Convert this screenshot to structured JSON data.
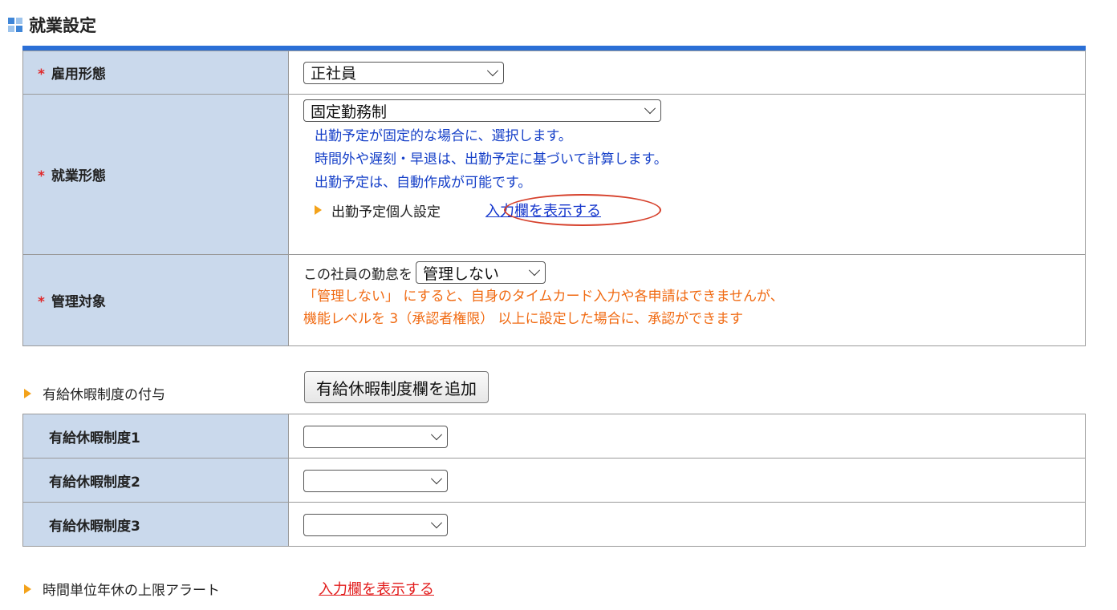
{
  "section": {
    "title": "就業設定",
    "icon": "grid-icon",
    "accent_color": "#2b6fd6"
  },
  "employment": {
    "required_mark": "*",
    "employment_type_label": "雇用形態",
    "employment_type_value": "正社員",
    "work_style_label": "就業形態",
    "work_style_value": "固定勤務制",
    "work_style_notes": [
      "出勤予定が固定的な場合に、選択します。",
      "時間外や遅刻・早退は、出勤予定に基づいて計算します。",
      "出勤予定は、自動作成が可能です。"
    ],
    "personal_schedule_label": "出勤予定個人設定",
    "personal_schedule_link": "入力欄を表示する",
    "managed_label": "管理対象",
    "managed_prefix": "この社員の勤怠を",
    "managed_value": "管理しない",
    "managed_notes": [
      "「管理しない」 にすると、自身のタイムカード入力や各申請はできませんが、",
      "機能レベルを 3（承認者権限） 以上に設定した場合に、承認ができます"
    ]
  },
  "paid_leave": {
    "grant_label": "有給休暇制度の付与",
    "add_button": "有給休暇制度欄を追加",
    "rows": [
      {
        "label": "有給休暇制度1",
        "value": ""
      },
      {
        "label": "有給休暇制度2",
        "value": ""
      },
      {
        "label": "有給休暇制度3",
        "value": ""
      }
    ]
  },
  "hourly_leave": {
    "label": "時間単位年休の上限アラート",
    "link": "入力欄を表示する"
  }
}
